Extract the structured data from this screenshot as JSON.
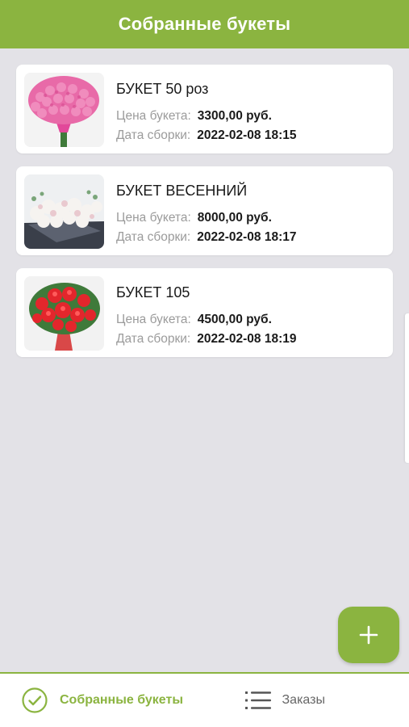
{
  "header": {
    "title": "Собранные букеты"
  },
  "bouquets": [
    {
      "title": "БУКЕТ 50 роз",
      "price_label": "Цена букета:",
      "price_value": "3300,00 руб.",
      "date_label": "Дата сборки:",
      "date_value": "2022-02-08 18:15",
      "image_icon": "pink-roses-bouquet-image"
    },
    {
      "title": "БУКЕТ ВЕСЕННИЙ",
      "price_label": "Цена букета:",
      "price_value": "8000,00 руб.",
      "date_label": "Дата сборки:",
      "date_value": "2022-02-08 18:17",
      "image_icon": "white-spring-bouquet-image"
    },
    {
      "title": "БУКЕТ 105",
      "price_label": "Цена букета:",
      "price_value": "4500,00 руб.",
      "date_label": "Дата сборки:",
      "date_value": "2022-02-08 18:19",
      "image_icon": "red-lilies-bouquet-image"
    }
  ],
  "fab": {
    "icon": "plus-icon"
  },
  "bottom_nav": {
    "items": [
      {
        "label": "Собранные букеты",
        "icon": "check-circle-icon",
        "active": true
      },
      {
        "label": "Заказы",
        "icon": "list-icon",
        "active": false
      }
    ]
  },
  "colors": {
    "accent": "#8bb440",
    "background": "#e3e2e7",
    "card": "#ffffff",
    "label": "#9b9b9b",
    "text": "#1a1a1a"
  }
}
